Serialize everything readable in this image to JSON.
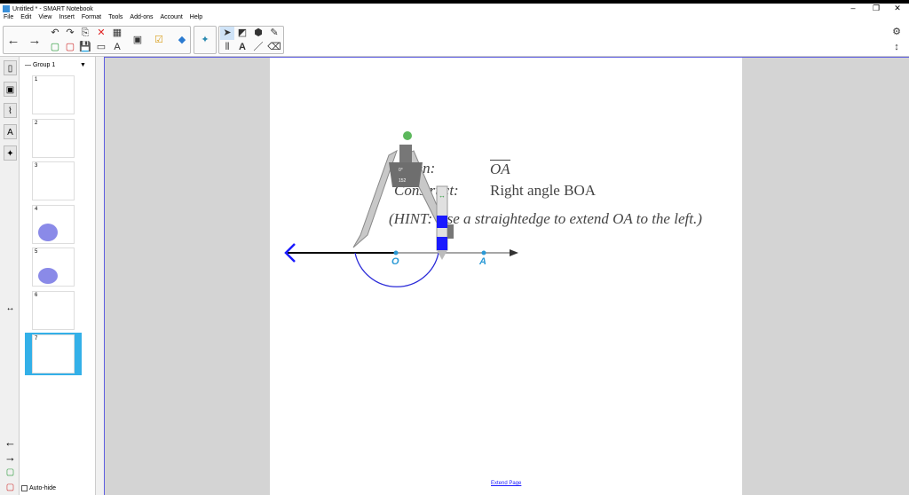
{
  "title": "Untitled * - SMART Notebook",
  "window_controls": {
    "minimize": "–",
    "restore": "❐",
    "close": "✕"
  },
  "menu": [
    "File",
    "Edit",
    "View",
    "Insert",
    "Format",
    "Tools",
    "Add-ons",
    "Account",
    "Help"
  ],
  "sorter": {
    "group_label": "Group 1",
    "pages": [
      "1",
      "2",
      "3",
      "4",
      "5",
      "6",
      "7"
    ],
    "auto_hide": "Auto-hide",
    "selected_page": "7"
  },
  "canvas": {
    "given_label": "Given:",
    "given_value": "OA",
    "construct_label": "Construct:",
    "construct_value": "Right angle BOA",
    "hint": "(HINT: Use a straightedge to extend OA to the left.)",
    "point_o": "O",
    "point_a": "A",
    "compass_angle": "0°",
    "compass_radius": "152",
    "extend_page": "Extend Page"
  },
  "colors": {
    "accent": "#1a1aff",
    "point": "#2b9ad6",
    "selected": "#33b0e8"
  }
}
